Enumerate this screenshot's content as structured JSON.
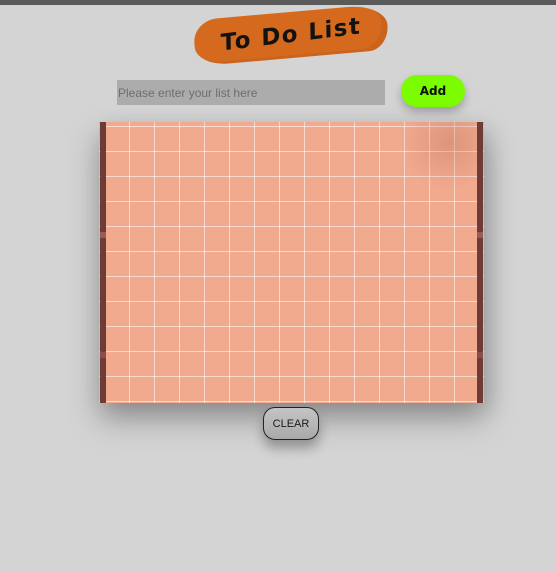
{
  "app": {
    "title": "To Do List"
  },
  "form": {
    "input_value": "",
    "input_placeholder": "Please enter your list here",
    "add_label": "Add"
  },
  "list": {
    "items": []
  },
  "actions": {
    "clear_label": "CLEAR"
  },
  "colors": {
    "background": "#d4d4d4",
    "title_badge": "#d56a1e",
    "add_button": "#7cfc00",
    "paper": "#f2aa8f",
    "paper_edge": "#6e3b37",
    "input_background": "#acacac"
  }
}
